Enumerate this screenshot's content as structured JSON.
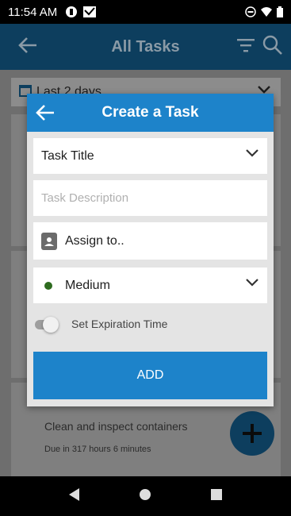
{
  "status_bar": {
    "time": "11:54 AM"
  },
  "app_bar": {
    "title": "All Tasks"
  },
  "background": {
    "filter_label": "Last 2 days",
    "task_title": "Clean and inspect containers",
    "task_due": "Due in 317 hours 6 minutes"
  },
  "dialog": {
    "title": "Create a Task",
    "task_title_label": "Task Title",
    "description_placeholder": "Task Description",
    "assign_label": "Assign to..",
    "priority_label": "Medium",
    "expiration_label": "Set Expiration Time",
    "expiration_enabled": false,
    "add_label": "ADD"
  },
  "colors": {
    "header_blue": "#1d83ca",
    "priority_green": "#2e6b1f",
    "app_bar_dimmed": "#0d3e5e"
  },
  "icons": {
    "back": "arrow-left-icon",
    "filter": "filter-icon",
    "search": "search-icon",
    "calendar": "calendar-icon",
    "chevron": "chevron-down-icon",
    "contact": "contact-card-icon",
    "add": "plus-icon"
  }
}
